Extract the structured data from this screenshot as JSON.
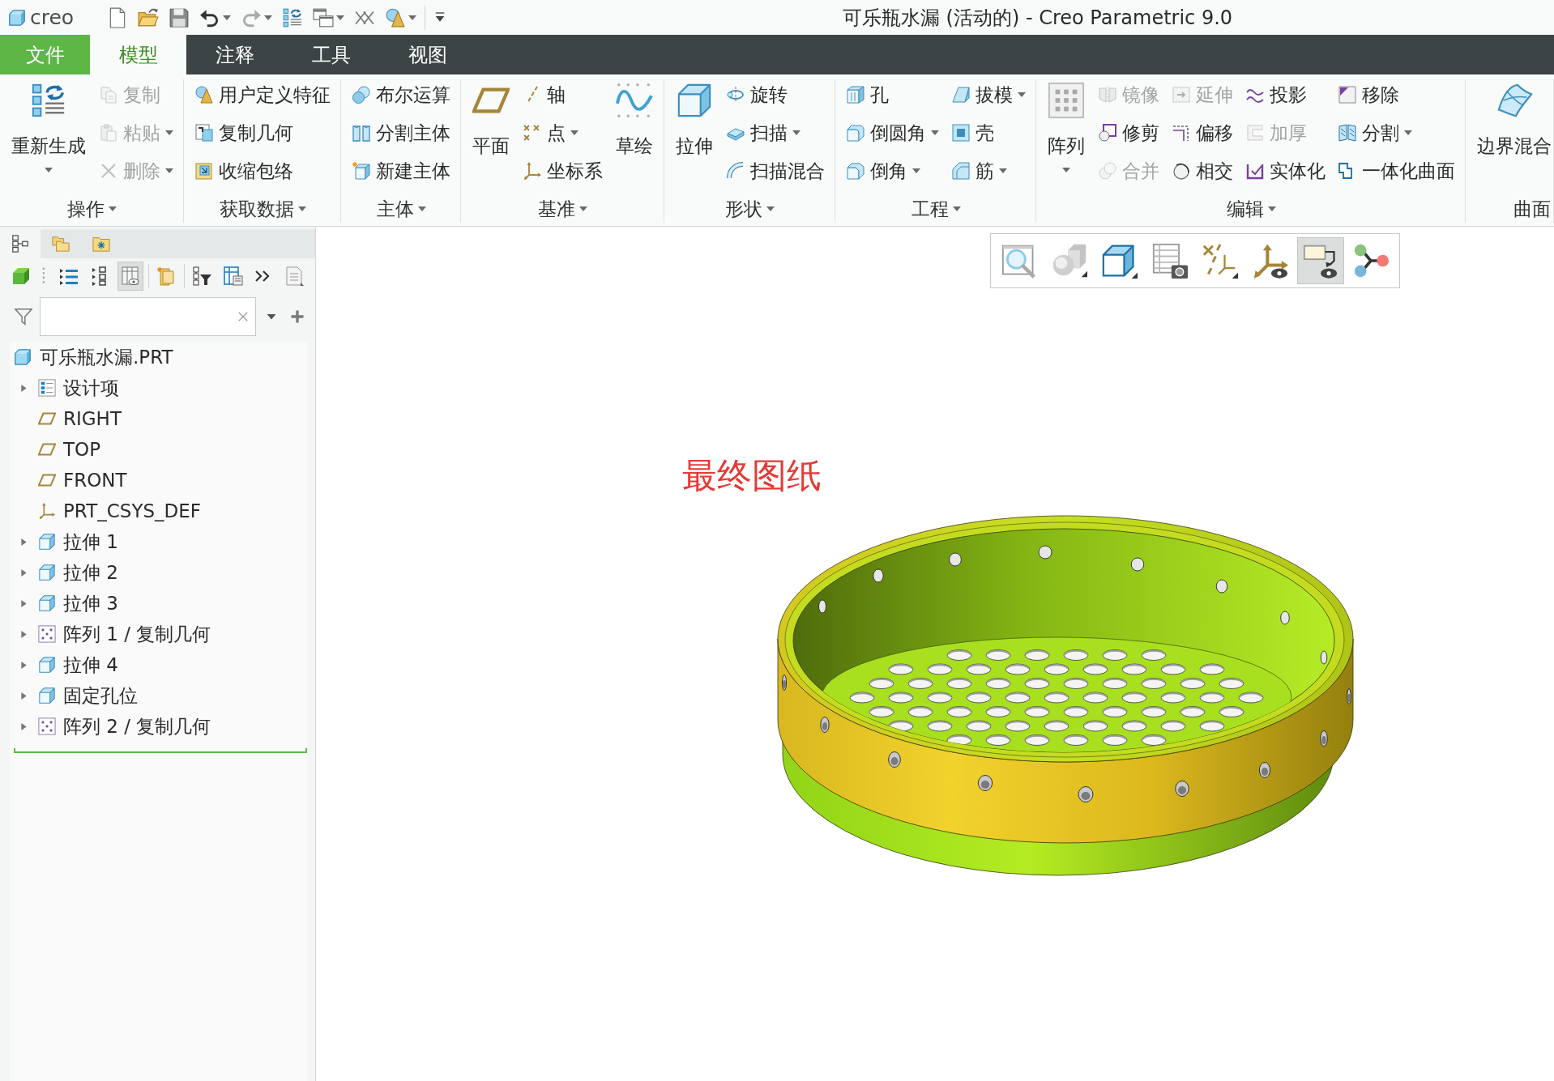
{
  "app_logo": "creo",
  "window": {
    "title": "可乐瓶水漏 (活动的) - Creo Parametric 9.0"
  },
  "tabs": [
    {
      "label": "文件",
      "kind": "file",
      "selected": false
    },
    {
      "label": "模型",
      "kind": "ribbon",
      "selected": true
    },
    {
      "label": "注释",
      "kind": "ribbon",
      "selected": false
    },
    {
      "label": "工具",
      "kind": "ribbon",
      "selected": false
    },
    {
      "label": "视图",
      "kind": "ribbon",
      "selected": false
    }
  ],
  "ribbon": {
    "groups": [
      {
        "label": "操作",
        "dropdown": true,
        "columns": [
          [
            {
              "label": "重新生成",
              "kind": "large",
              "dropdown": true,
              "disabled": false
            }
          ],
          [
            {
              "label": "复制",
              "kind": "small",
              "dropdown": false,
              "disabled": true
            },
            {
              "label": "粘贴",
              "kind": "small",
              "dropdown": true,
              "disabled": true
            },
            {
              "label": "删除",
              "kind": "small",
              "dropdown": true,
              "disabled": true
            }
          ]
        ]
      },
      {
        "label": "获取数据",
        "dropdown": true,
        "columns": [
          [
            {
              "label": "用户定义特征",
              "kind": "small",
              "dropdown": false,
              "disabled": false
            },
            {
              "label": "复制几何",
              "kind": "small",
              "dropdown": false,
              "disabled": false
            },
            {
              "label": "收缩包络",
              "kind": "small",
              "dropdown": false,
              "disabled": false
            }
          ]
        ]
      },
      {
        "label": "主体",
        "dropdown": true,
        "columns": [
          [
            {
              "label": "布尔运算",
              "kind": "small",
              "dropdown": false,
              "disabled": false
            },
            {
              "label": "分割主体",
              "kind": "small",
              "dropdown": false,
              "disabled": false
            },
            {
              "label": "新建主体",
              "kind": "small",
              "dropdown": false,
              "disabled": false
            }
          ]
        ]
      },
      {
        "label": "基准",
        "dropdown": true,
        "columns": [
          [
            {
              "label": "平面",
              "kind": "large",
              "dropdown": false,
              "disabled": false
            }
          ],
          [
            {
              "label": "轴",
              "kind": "small",
              "dropdown": false,
              "disabled": false
            },
            {
              "label": "点",
              "kind": "small",
              "dropdown": true,
              "disabled": false
            },
            {
              "label": "坐标系",
              "kind": "small",
              "dropdown": false,
              "disabled": false
            }
          ],
          [
            {
              "label": "草绘",
              "kind": "large",
              "dropdown": false,
              "disabled": false
            }
          ]
        ]
      },
      {
        "label": "形状",
        "dropdown": true,
        "columns": [
          [
            {
              "label": "拉伸",
              "kind": "large",
              "dropdown": false,
              "disabled": false
            }
          ],
          [
            {
              "label": "旋转",
              "kind": "small",
              "dropdown": false,
              "disabled": false
            },
            {
              "label": "扫描",
              "kind": "small",
              "dropdown": true,
              "disabled": false
            },
            {
              "label": "扫描混合",
              "kind": "small",
              "dropdown": false,
              "disabled": false
            }
          ]
        ]
      },
      {
        "label": "工程",
        "dropdown": true,
        "columns": [
          [
            {
              "label": "孔",
              "kind": "small",
              "dropdown": false,
              "disabled": false
            },
            {
              "label": "倒圆角",
              "kind": "small",
              "dropdown": true,
              "disabled": false
            },
            {
              "label": "倒角",
              "kind": "small",
              "dropdown": true,
              "disabled": false
            }
          ],
          [
            {
              "label": "拔模",
              "kind": "small",
              "dropdown": true,
              "disabled": false
            },
            {
              "label": "壳",
              "kind": "small",
              "dropdown": false,
              "disabled": false
            },
            {
              "label": "筋",
              "kind": "small",
              "dropdown": true,
              "disabled": false
            }
          ]
        ]
      },
      {
        "label": "编辑",
        "dropdown": true,
        "columns": [
          [
            {
              "label": "阵列",
              "kind": "large",
              "dropdown": true,
              "disabled": false
            }
          ],
          [
            {
              "label": "镜像",
              "kind": "small",
              "dropdown": false,
              "disabled": true
            },
            {
              "label": "修剪",
              "kind": "small",
              "dropdown": false,
              "disabled": false
            },
            {
              "label": "合并",
              "kind": "small",
              "dropdown": false,
              "disabled": true
            }
          ],
          [
            {
              "label": "延伸",
              "kind": "small",
              "dropdown": false,
              "disabled": true
            },
            {
              "label": "偏移",
              "kind": "small",
              "dropdown": false,
              "disabled": false
            },
            {
              "label": "相交",
              "kind": "small",
              "dropdown": false,
              "disabled": false
            }
          ],
          [
            {
              "label": "投影",
              "kind": "small",
              "dropdown": false,
              "disabled": false
            },
            {
              "label": "加厚",
              "kind": "small",
              "dropdown": false,
              "disabled": true
            },
            {
              "label": "实体化",
              "kind": "small",
              "dropdown": false,
              "disabled": false
            }
          ],
          [
            {
              "label": "移除",
              "kind": "small",
              "dropdown": false,
              "disabled": false
            },
            {
              "label": "分割",
              "kind": "small",
              "dropdown": true,
              "disabled": false
            },
            {
              "label": "一体化曲面",
              "kind": "small",
              "dropdown": false,
              "disabled": false
            }
          ]
        ]
      },
      {
        "label": "曲面",
        "dropdown": false,
        "columns": [
          [
            {
              "label": "边界混合",
              "kind": "large",
              "dropdown": false,
              "disabled": false
            }
          ]
        ]
      }
    ]
  },
  "model_tree": {
    "panel_tabs": [
      {
        "selected": true
      },
      {
        "selected": false
      },
      {
        "selected": false
      }
    ],
    "toolbar": [
      {
        "pressed": false
      },
      {
        "pressed": false
      },
      {
        "pressed": false
      },
      {
        "pressed": true
      },
      {
        "pressed": false
      },
      {
        "pressed": false
      },
      {
        "pressed": false
      },
      {
        "pressed": false
      },
      {
        "pressed": false
      }
    ],
    "tree": {
      "label": "可乐瓶水漏.PRT",
      "kind": "part",
      "children": [
        {
          "label": "设计项",
          "kind": "items",
          "expandable": true
        },
        {
          "label": "RIGHT",
          "kind": "plane",
          "expandable": false
        },
        {
          "label": "TOP",
          "kind": "plane",
          "expandable": false
        },
        {
          "label": "FRONT",
          "kind": "plane",
          "expandable": false
        },
        {
          "label": "PRT_CSYS_DEF",
          "kind": "csys",
          "expandable": false
        },
        {
          "label": "拉伸 1",
          "kind": "solid",
          "expandable": true
        },
        {
          "label": "拉伸 2",
          "kind": "solid",
          "expandable": true
        },
        {
          "label": "拉伸 3",
          "kind": "solid",
          "expandable": true
        },
        {
          "label": "阵列 1 / 复制几何",
          "kind": "pattern",
          "expandable": true
        },
        {
          "label": "拉伸 4",
          "kind": "solid",
          "expandable": true
        },
        {
          "label": "固定孔位",
          "kind": "solid",
          "expandable": true
        },
        {
          "label": "阵列 2 / 复制几何",
          "kind": "pattern",
          "expandable": true
        }
      ]
    }
  },
  "graphics": {
    "annotation": "最终图纸",
    "toolbar": [
      {
        "pressed": false
      },
      {
        "pressed": false
      },
      {
        "pressed": false
      },
      {
        "pressed": false
      },
      {
        "pressed": false
      },
      {
        "pressed": false
      },
      {
        "pressed": true
      },
      {
        "pressed": false
      }
    ]
  }
}
